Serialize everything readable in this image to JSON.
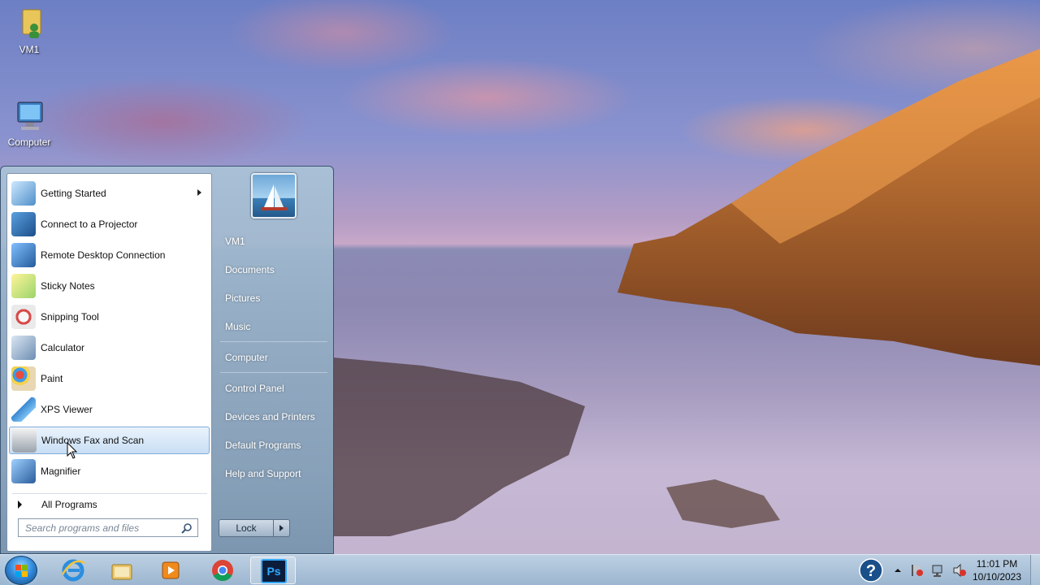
{
  "desktop": {
    "icons": [
      {
        "label": "VM1",
        "icon": "user-folder-icon"
      },
      {
        "label": "Computer",
        "icon": "computer-icon"
      }
    ]
  },
  "start_menu": {
    "programs": [
      {
        "label": "Getting Started",
        "icon": "getting-started-icon",
        "has_submenu": true
      },
      {
        "label": "Connect to a Projector",
        "icon": "projector-icon"
      },
      {
        "label": "Remote Desktop Connection",
        "icon": "remote-desktop-icon"
      },
      {
        "label": "Sticky Notes",
        "icon": "sticky-notes-icon"
      },
      {
        "label": "Snipping Tool",
        "icon": "snipping-tool-icon"
      },
      {
        "label": "Calculator",
        "icon": "calculator-icon"
      },
      {
        "label": "Paint",
        "icon": "paint-icon"
      },
      {
        "label": "XPS Viewer",
        "icon": "xps-viewer-icon"
      },
      {
        "label": "Windows Fax and Scan",
        "icon": "fax-scan-icon",
        "highlighted": true
      },
      {
        "label": "Magnifier",
        "icon": "magnifier-icon"
      }
    ],
    "all_programs": "All Programs",
    "search_placeholder": "Search programs and files",
    "right_links": [
      "VM1",
      "Documents",
      "Pictures",
      "Music",
      "Computer",
      "Control Panel",
      "Devices and Printers",
      "Default Programs",
      "Help and Support"
    ],
    "lock_label": "Lock"
  },
  "taskbar": {
    "pinned": [
      "internet-explorer-icon",
      "file-explorer-icon",
      "media-player-icon",
      "chrome-icon",
      "photoshop-icon"
    ],
    "photoshop_label": "Ps",
    "time": "11:01 PM",
    "date": "10/10/2023"
  },
  "colors": {
    "highlight": "#c8def4",
    "taskbar": "#a5bfd9",
    "start_menu_right": "#8ea6be"
  }
}
